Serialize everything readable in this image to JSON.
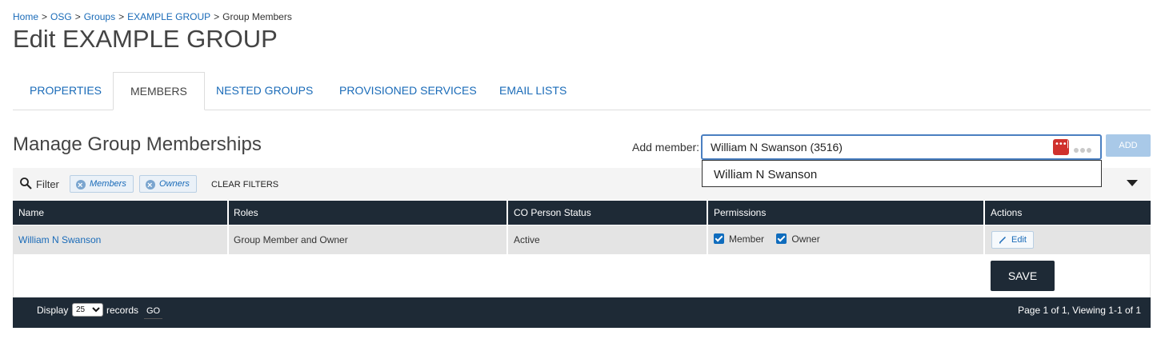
{
  "breadcrumb": {
    "items": [
      "Home",
      "OSG",
      "Groups",
      "EXAMPLE GROUP"
    ],
    "current": "Group Members",
    "separator": ">"
  },
  "page_title": "Edit EXAMPLE GROUP",
  "tabs": [
    {
      "label": "PROPERTIES",
      "active": false
    },
    {
      "label": "MEMBERS",
      "active": true
    },
    {
      "label": "NESTED GROUPS",
      "active": false
    },
    {
      "label": "PROVISIONED SERVICES",
      "active": false
    },
    {
      "label": "EMAIL LISTS",
      "active": false
    }
  ],
  "section_title": "Manage Group Memberships",
  "add_member": {
    "label": "Add member:",
    "value": "William N Swanson (3516)",
    "button": "ADD",
    "suggestions": [
      "William N Swanson"
    ]
  },
  "filter": {
    "label": "Filter",
    "chips": [
      "Members",
      "Owners"
    ],
    "clear": "CLEAR FILTERS"
  },
  "table": {
    "headers": [
      "Name",
      "Roles",
      "CO Person Status",
      "Permissions",
      "Actions"
    ],
    "rows": [
      {
        "name": "William N Swanson",
        "roles": "Group Member and Owner",
        "status": "Active",
        "permissions": [
          {
            "label": "Member",
            "checked": true
          },
          {
            "label": "Owner",
            "checked": true
          }
        ],
        "action": "Edit"
      }
    ]
  },
  "save_label": "SAVE",
  "pagination": {
    "display_label": "Display",
    "per_page": "25",
    "records_label": "records",
    "go_label": "GO",
    "info": "Page 1 of 1, Viewing 1-1 of 1"
  },
  "colors": {
    "link": "#1a6bb8",
    "header_bg": "#1e2a36",
    "row_bg": "#e4e4e4",
    "add_button_disabled": "#a9c9e8",
    "password_manager_badge": "#d0312d"
  }
}
